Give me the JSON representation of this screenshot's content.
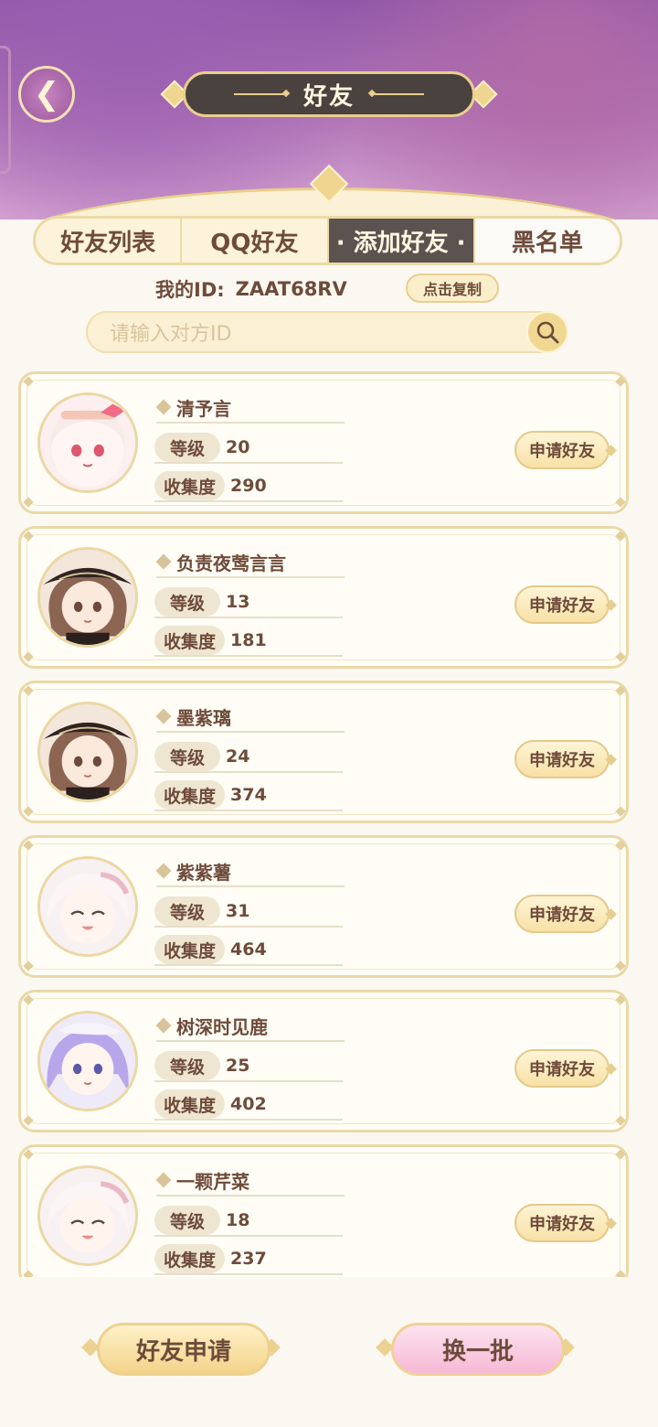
{
  "header": {
    "title": "好友"
  },
  "tabs": [
    {
      "label": "好友列表",
      "active": false
    },
    {
      "label": "QQ好友",
      "active": false
    },
    {
      "label": "· 添加好友 ·",
      "active": true
    },
    {
      "label": "黑名单",
      "active": false
    }
  ],
  "my_id": {
    "label": "我的ID:",
    "value": "ZAAT68RV",
    "copy_label": "点击复制"
  },
  "search": {
    "placeholder": "请输入对方ID"
  },
  "stat_labels": {
    "level": "等级",
    "collection": "收集度"
  },
  "users": [
    {
      "name": "清予言",
      "level": "20",
      "collection": "290",
      "avatar": "pink-bow-girl",
      "apply_label": "申请好友"
    },
    {
      "name": "负责夜莺言言",
      "level": "13",
      "collection": "181",
      "avatar": "brown-hat-girl",
      "apply_label": "申请好友"
    },
    {
      "name": "墨紫璃",
      "level": "24",
      "collection": "374",
      "avatar": "brown-hat-girl",
      "apply_label": "申请好友"
    },
    {
      "name": "紫紫薯",
      "level": "31",
      "collection": "464",
      "avatar": "white-hair-girl",
      "apply_label": "申请好友"
    },
    {
      "name": "树深时见鹿",
      "level": "25",
      "collection": "402",
      "avatar": "purple-hair-girl",
      "apply_label": "申请好友"
    },
    {
      "name": "一颗芹菜",
      "level": "18",
      "collection": "237",
      "avatar": "white-hair-girl",
      "apply_label": "申请好友"
    }
  ],
  "bottom": {
    "requests_label": "好友申请",
    "refresh_label": "换一批"
  },
  "colors": {
    "active_tab": "#5c5350",
    "accent_gold": "#ead8a8",
    "header_purple": "#8e56a8",
    "refresh_pink": "#f6b9d6"
  }
}
